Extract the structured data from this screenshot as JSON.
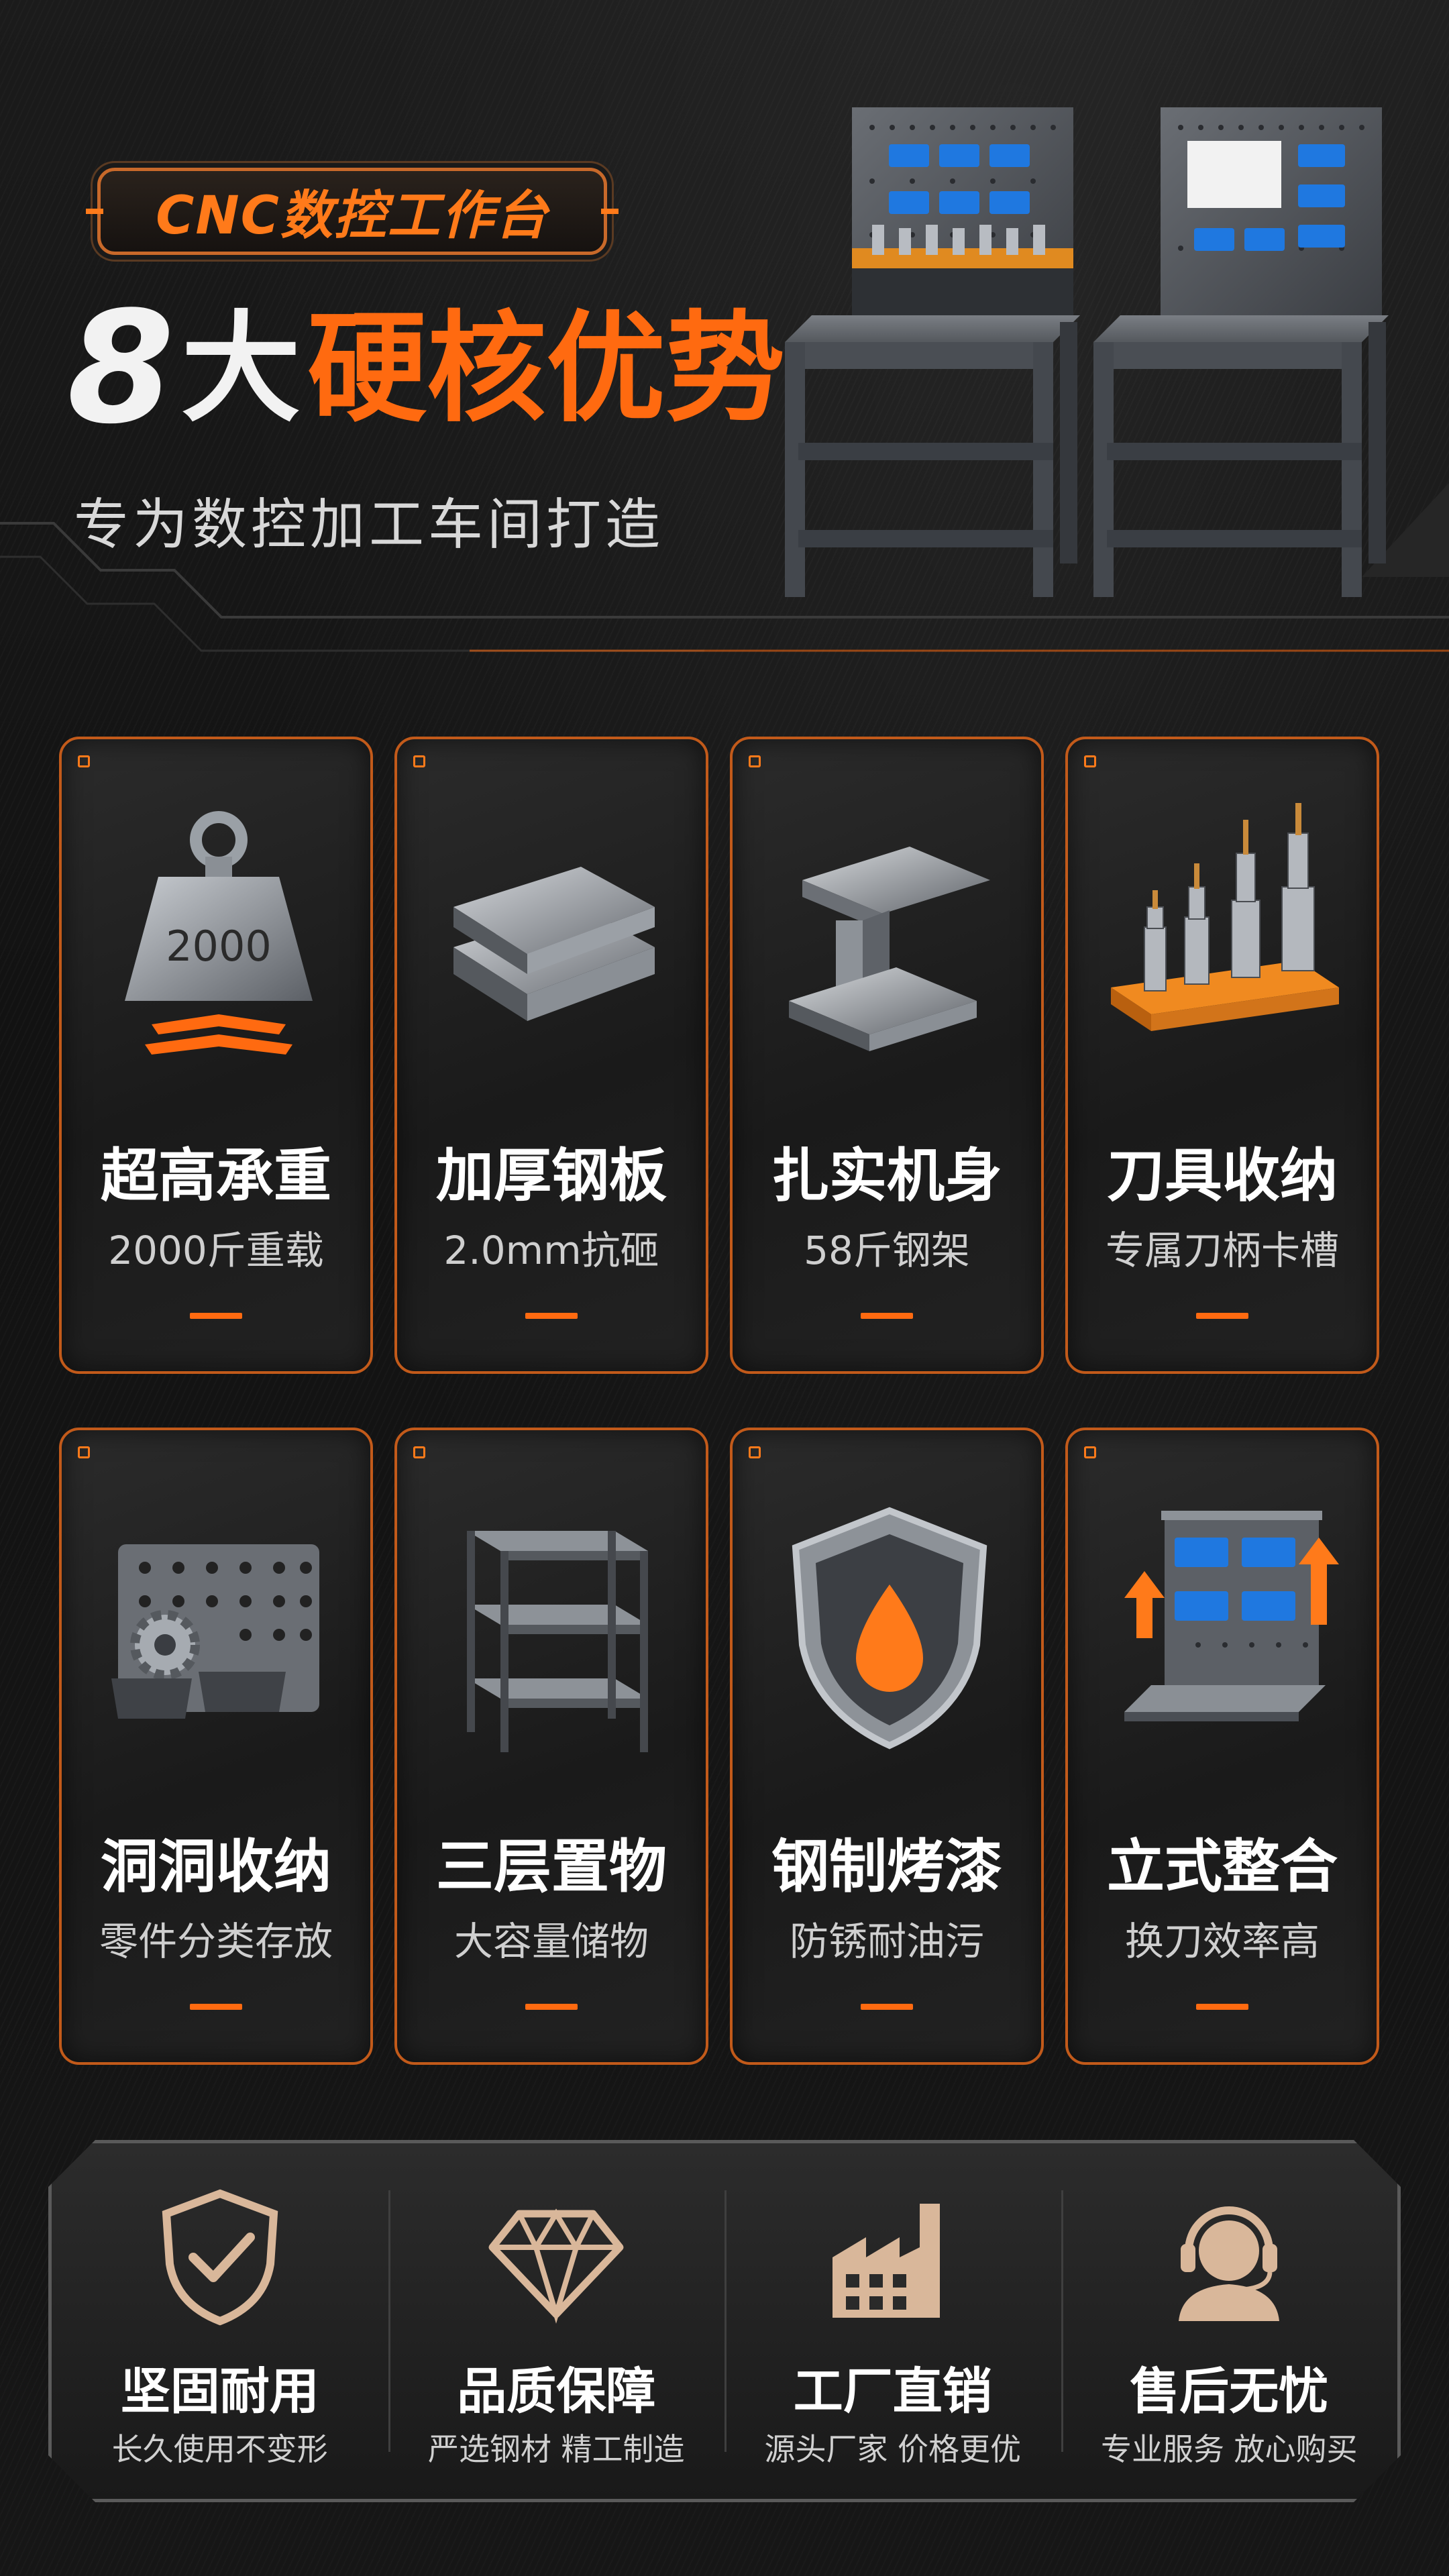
{
  "header": {
    "badge": "CNC数控工作台",
    "headline_num": "8",
    "headline_mid": "大",
    "headline_accent": "硬核优势",
    "subtitle": "专为数控加工车间打造"
  },
  "colors": {
    "accent": "#ff6a10",
    "card_border": "#c25a1a",
    "bin_blue": "#1f78e0",
    "background": "#141414"
  },
  "features": [
    {
      "title": "超高承重",
      "desc": "2000斤重载",
      "icon": "weight-icon",
      "icon_text": "2000"
    },
    {
      "title": "加厚钢板",
      "desc": "2.0mm抗砸",
      "icon": "steel-plate-icon"
    },
    {
      "title": "扎实机身",
      "desc": "58斤钢架",
      "icon": "i-beam-icon"
    },
    {
      "title": "刀具收纳",
      "desc": "专属刀柄卡槽",
      "icon": "tool-holder-icon"
    },
    {
      "title": "洞洞收纳",
      "desc": "零件分类存放",
      "icon": "pegboard-icon"
    },
    {
      "title": "三层置物",
      "desc": "大容量储物",
      "icon": "shelf-icon"
    },
    {
      "title": "钢制烤漆",
      "desc": "防锈耐油污",
      "icon": "shield-drop-icon"
    },
    {
      "title": "立式整合",
      "desc": "换刀效率高",
      "icon": "upright-board-icon"
    }
  ],
  "guarantees": [
    {
      "title": "坚固耐用",
      "desc": "长久使用不变形",
      "icon": "shield-check-icon"
    },
    {
      "title": "品质保障",
      "desc": "严选钢材 精工制造",
      "icon": "diamond-icon"
    },
    {
      "title": "工厂直销",
      "desc": "源头厂家 价格更优",
      "icon": "factory-icon"
    },
    {
      "title": "售后无忧",
      "desc": "专业服务 放心购买",
      "icon": "support-agent-icon"
    }
  ]
}
